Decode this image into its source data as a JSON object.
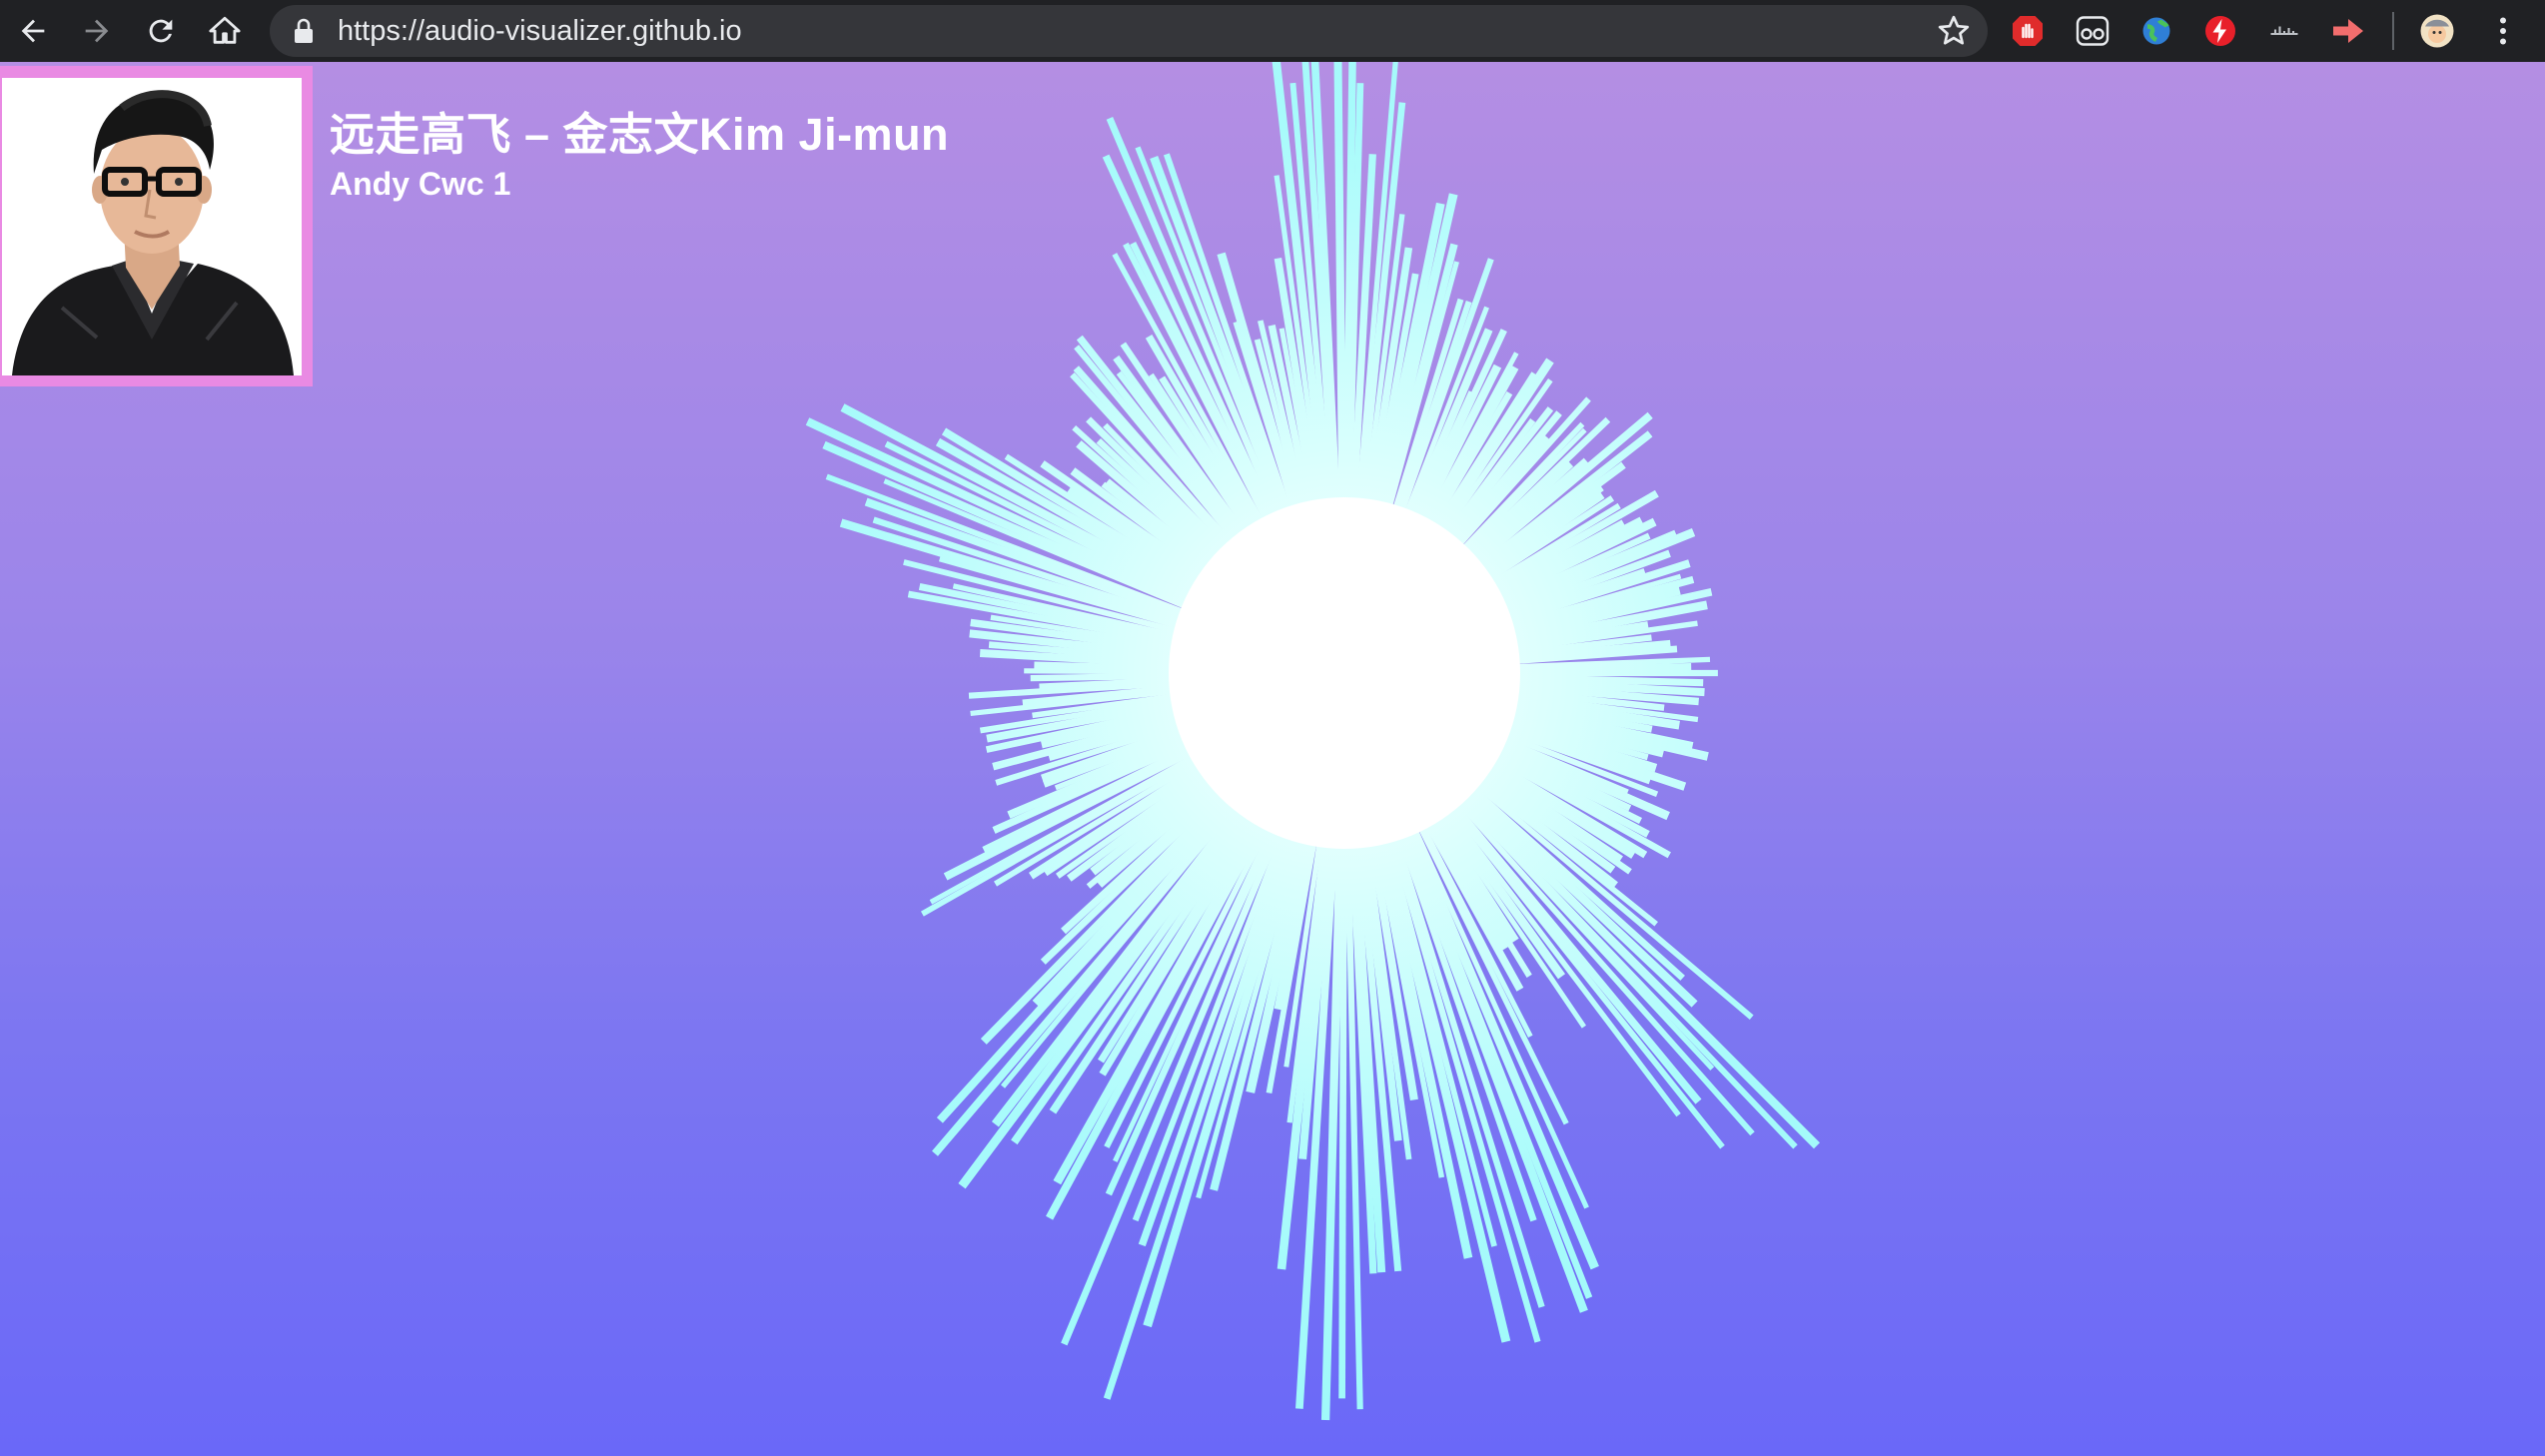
{
  "browser": {
    "url": "https://audio-visualizer.github.io",
    "nav": {
      "back_icon": "arrow-left-icon",
      "forward_icon": "arrow-right-icon",
      "reload_icon": "reload-icon",
      "home_icon": "home-icon"
    },
    "extensions": [
      "adblock-hand-icon",
      "glasses-icon",
      "globe-icon",
      "lightning-icon",
      "waveform-icon",
      "forward-arrow-icon"
    ],
    "colors": {
      "toolbar": "#202124",
      "omnibox": "#35363a",
      "text": "#e8eaed"
    }
  },
  "player": {
    "song_title": "远走高飞 – 金志文Kim Ji-mun",
    "artist": "Andy Cwc 1",
    "cover_icon": "album-cover-portrait",
    "colors": {
      "background_top": "#b48ee3",
      "background_bottom": "#6a68f8",
      "cover_border": "#e98ae3",
      "bars": "#a8fbfb",
      "center_circle": "#ffffff"
    }
  }
}
